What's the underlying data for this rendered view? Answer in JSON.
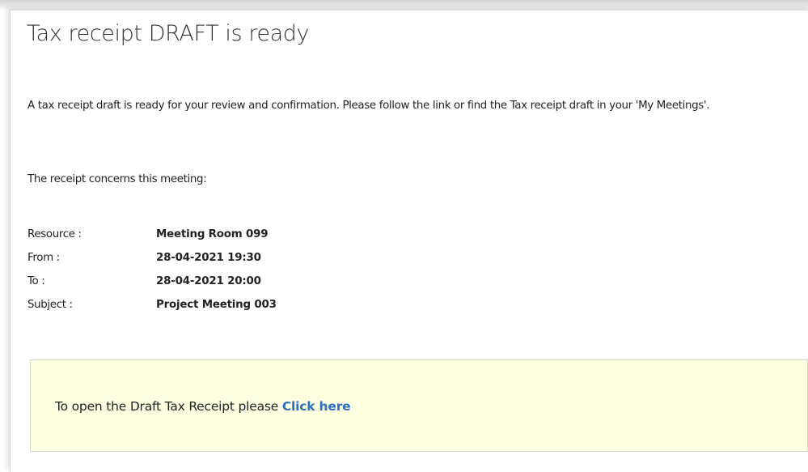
{
  "email": {
    "title": "Tax receipt DRAFT is ready",
    "intro": "A tax receipt draft is ready for your review and confirmation. Please follow the link or find the Tax receipt draft in your 'My Meetings'.",
    "concerns": "The receipt concerns this meeting:",
    "details": [
      {
        "label": "Resource :",
        "value": "Meeting Room 099"
      },
      {
        "label": "From :",
        "value": "28-04-2021 19:30"
      },
      {
        "label": "To :",
        "value": "28-04-2021 20:00"
      },
      {
        "label": "Subject :",
        "value": "Project Meeting 003"
      }
    ],
    "notice": {
      "text": "To open the Draft Tax Receipt please",
      "link_label": "Click here"
    }
  },
  "colors": {
    "link": "#2f6fbf",
    "notice_background": "#ffffe1",
    "text": "#222222"
  }
}
